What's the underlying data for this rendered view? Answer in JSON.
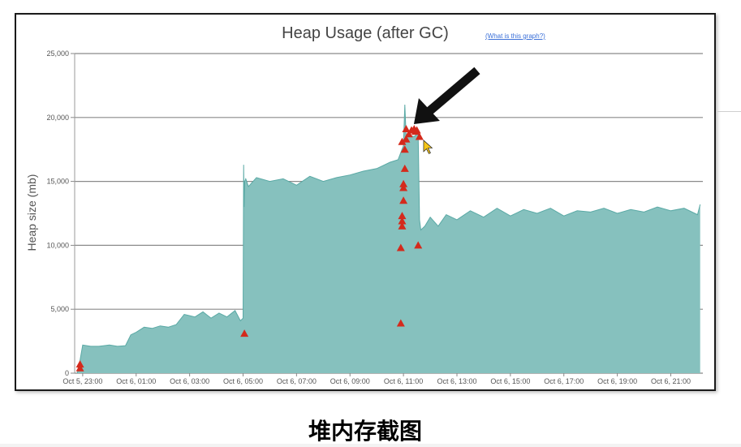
{
  "chart_data": {
    "type": "area",
    "title": "Heap Usage (after GC)",
    "help_link": "(What is this graph?)",
    "ylabel": "Heap size (mb)",
    "xlabel": "",
    "ylim": [
      0,
      25000
    ],
    "grid": true,
    "y_ticks": [
      "0",
      "5,000",
      "10,000",
      "15,000",
      "20,000",
      "25,000"
    ],
    "y_tick_values": [
      0,
      5000,
      10000,
      15000,
      20000,
      25000
    ],
    "x_ticks": [
      "Oct 5, 23:00",
      "Oct 6, 01:00",
      "Oct 6, 03:00",
      "Oct 6, 05:00",
      "Oct 6, 07:00",
      "Oct 6, 09:00",
      "Oct 6, 11:00",
      "Oct 6, 13:00",
      "Oct 6, 15:00",
      "Oct 6, 17:00",
      "Oct 6, 19:00",
      "Oct 6, 21:00"
    ],
    "x_tick_hours": [
      0,
      2,
      4,
      6,
      8,
      10,
      12,
      14,
      16,
      18,
      20,
      22
    ],
    "xlim": [
      -0.3,
      23.2
    ],
    "fill_color": "#86c1be",
    "line_color": "#5aa9a5",
    "marker_color": "#d42a1c",
    "series": [
      {
        "x": [
          -0.2,
          -0.1,
          0.0,
          0.3,
          0.6,
          1.0,
          1.3,
          1.6,
          1.8,
          2.0,
          2.3,
          2.6,
          2.9,
          3.2,
          3.5,
          3.8,
          4.0,
          4.2,
          4.5,
          4.8,
          5.1,
          5.4,
          5.7,
          5.9,
          6.0,
          6.02,
          6.04,
          6.06,
          6.1,
          6.2,
          6.5,
          7.0,
          7.5,
          8.0,
          8.5,
          9.0,
          9.5,
          10.0,
          10.5,
          11.0,
          11.5,
          11.8,
          12.0,
          12.05,
          12.1,
          12.2,
          12.4,
          12.55,
          12.6,
          12.65,
          12.8,
          13.0,
          13.3,
          13.6,
          14.0,
          14.5,
          15.0,
          15.5,
          16.0,
          16.5,
          17.0,
          17.5,
          18.0,
          18.5,
          19.0,
          19.5,
          20.0,
          20.5,
          21.0,
          21.5,
          22.0,
          22.5,
          23.0,
          23.1
        ],
        "y": [
          0,
          1000,
          2200,
          2100,
          2100,
          2200,
          2100,
          2150,
          3000,
          3200,
          3600,
          3500,
          3700,
          3600,
          3800,
          4600,
          4500,
          4400,
          4800,
          4300,
          4700,
          4400,
          4900,
          4100,
          4300,
          16300,
          13000,
          15000,
          15200,
          14600,
          15300,
          15000,
          15200,
          14700,
          15400,
          15000,
          15300,
          15500,
          15800,
          16000,
          16500,
          16700,
          17800,
          21000,
          18500,
          18600,
          18500,
          18800,
          12000,
          11200,
          11500,
          12200,
          11500,
          12400,
          12000,
          12700,
          12200,
          12900,
          12300,
          12800,
          12500,
          12900,
          12300,
          12700,
          12600,
          12900,
          12500,
          12800,
          12600,
          13000,
          12700,
          12900,
          12400,
          13200
        ]
      }
    ],
    "markers": {
      "x": [
        -0.1,
        -0.1,
        6.05,
        11.9,
        11.9,
        11.95,
        11.95,
        11.95,
        12.0,
        12.0,
        12.0,
        12.05,
        12.05,
        12.1,
        12.2,
        12.3,
        12.4,
        12.5,
        12.6,
        12.55,
        11.95,
        12.1,
        12.45
      ],
      "y": [
        700,
        400,
        3100,
        3900,
        9800,
        11500,
        11900,
        12300,
        13500,
        14500,
        14800,
        16000,
        17500,
        18300,
        18700,
        19000,
        19100,
        19000,
        18500,
        10000,
        18100,
        19100,
        18900
      ]
    },
    "arrow_target": {
      "x": 12.45,
      "y": 19800
    },
    "caption": "堆内存截图"
  }
}
